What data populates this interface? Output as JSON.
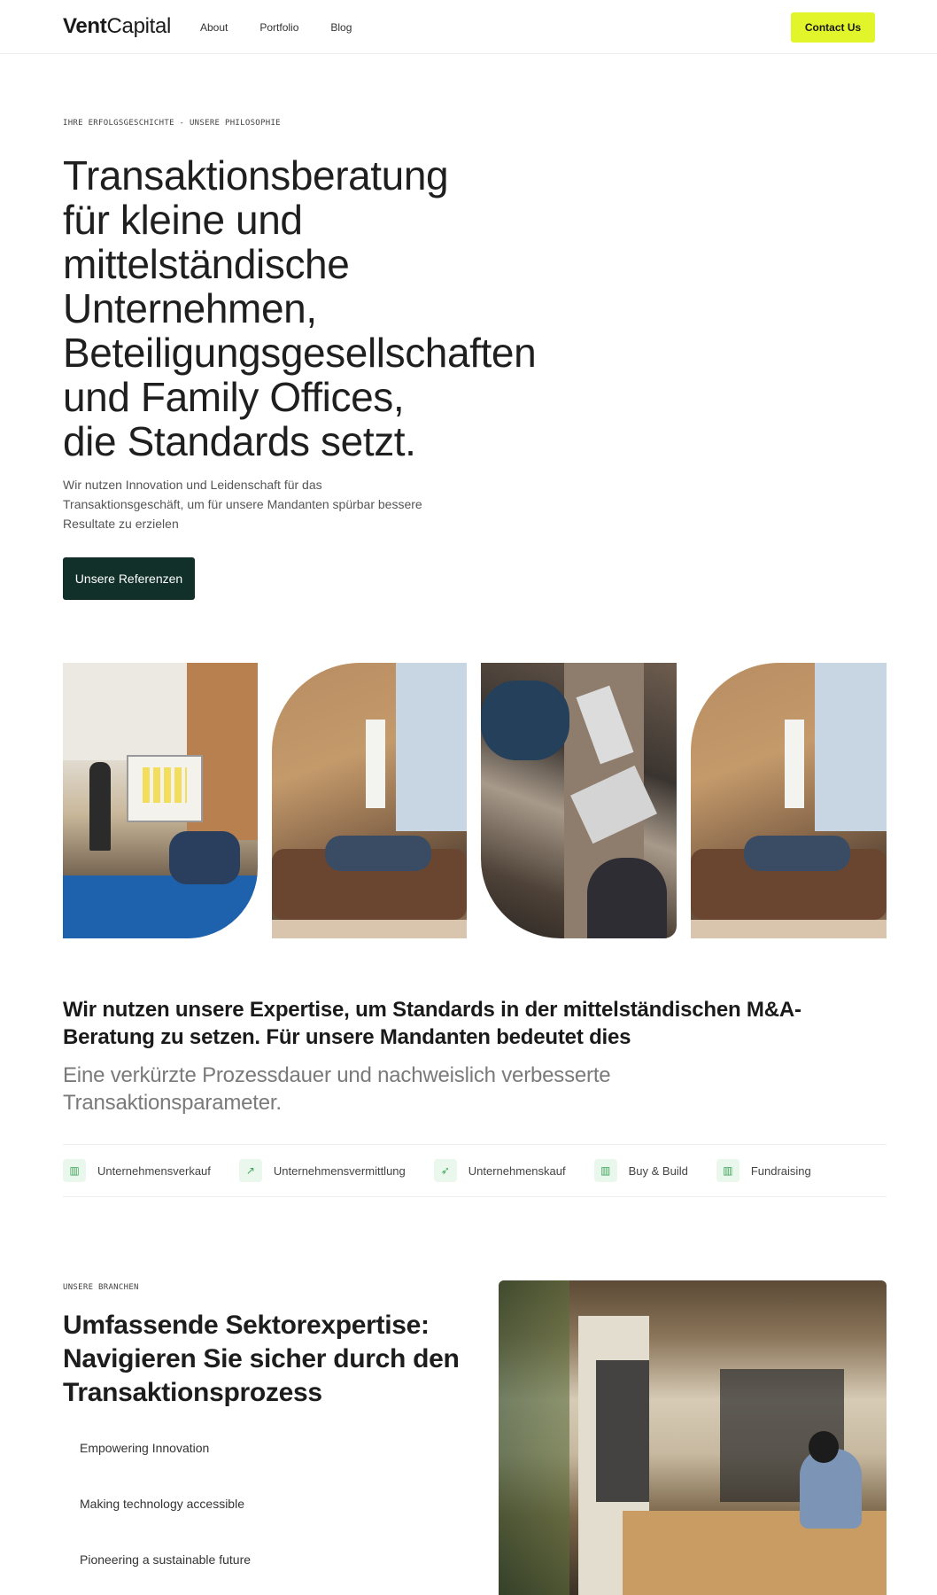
{
  "nav": {
    "logo_bold": "Vent",
    "logo_light": "Capital",
    "links": [
      "About",
      "Portfolio",
      "Blog"
    ],
    "cta": "Contact Us"
  },
  "hero": {
    "eyebrow": "IHRE ERFOLGSGESCHICHTE - UNSERE PHILOSOPHIE",
    "title_lines": [
      "Transaktionsberatung",
      "für kleine und",
      "mittelständische",
      "Unternehmen,",
      "Beteiligungsgesellschaften",
      "und Family Offices,",
      "die Standards setzt."
    ],
    "subtitle": "Wir nutzen Innovation und Leidenschaft für das Transaktionsgeschäft, um für unsere Mandanten spürbar bessere Resultate zu erzielen",
    "button": "Unsere Referenzen"
  },
  "expertise": {
    "title": "Wir nutzen unsere Expertise, um Standards in der mittelständischen M&A-Beratung zu setzen. Für unsere Mandanten bedeutet dies",
    "subtitle": "Eine verkürzte Prozessdauer und nachweislich verbesserte Transaktionsparameter.",
    "services": [
      {
        "label": "Unternehmensverkauf",
        "icon": "building-icon"
      },
      {
        "label": "Unternehmensvermittlung",
        "icon": "trend-up-icon"
      },
      {
        "label": "Unternehmenskauf",
        "icon": "rocket-icon"
      },
      {
        "label": "Buy & Build",
        "icon": "building-icon"
      },
      {
        "label": "Fundraising",
        "icon": "building-icon"
      }
    ]
  },
  "sectors": {
    "eyebrow": "UNSERE BRANCHEN",
    "title": "Umfassende Sektorexpertise: Navigieren Sie sicher durch den Transaktionsprozess",
    "items": [
      "Empowering Innovation",
      "Making technology accessible",
      "Pioneering a sustainable future"
    ]
  },
  "colors": {
    "accent": "#e2f52a",
    "primary_dark": "#12302a",
    "service_icon_bg": "#eaf7ec",
    "service_icon_fg": "#3ea55a"
  }
}
